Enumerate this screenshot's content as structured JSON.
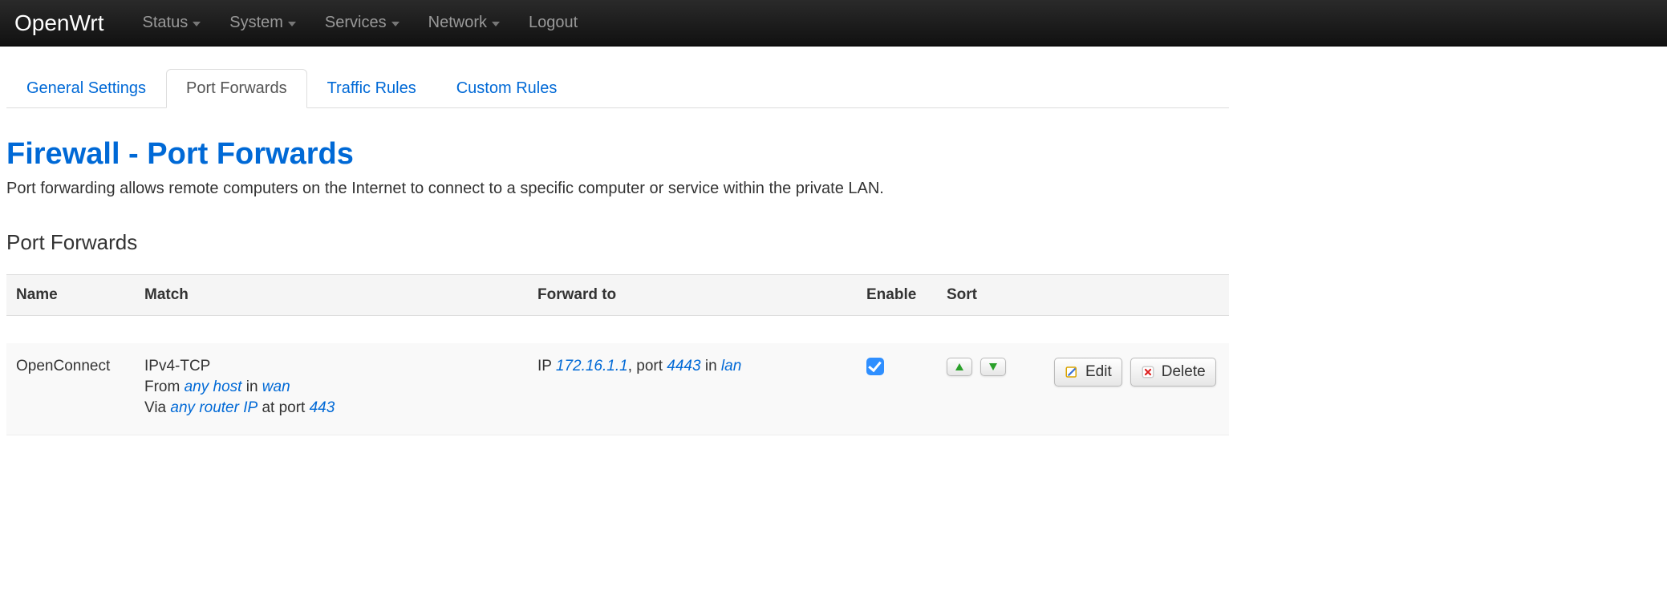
{
  "brand": "OpenWrt",
  "nav": {
    "items": [
      {
        "label": "Status",
        "dropdown": true
      },
      {
        "label": "System",
        "dropdown": true
      },
      {
        "label": "Services",
        "dropdown": true
      },
      {
        "label": "Network",
        "dropdown": true
      },
      {
        "label": "Logout",
        "dropdown": false
      }
    ]
  },
  "tabs": [
    {
      "label": "General Settings",
      "active": false
    },
    {
      "label": "Port Forwards",
      "active": true
    },
    {
      "label": "Traffic Rules",
      "active": false
    },
    {
      "label": "Custom Rules",
      "active": false
    }
  ],
  "page": {
    "title": "Firewall - Port Forwards",
    "description": "Port forwarding allows remote computers on the Internet to connect to a specific computer or service within the private LAN."
  },
  "section": {
    "title": "Port Forwards"
  },
  "table": {
    "headers": {
      "name": "Name",
      "match": "Match",
      "forward_to": "Forward to",
      "enable": "Enable",
      "sort": "Sort"
    }
  },
  "rows": [
    {
      "name": "OpenConnect",
      "match": {
        "proto": "IPv4-TCP",
        "from_prefix": "From ",
        "from_host": "any host",
        "from_mid": " in ",
        "from_zone": "wan",
        "via_prefix": "Via ",
        "via_ip": "any router IP",
        "via_mid": " at port ",
        "via_port": "443"
      },
      "forward": {
        "ip_prefix": "IP ",
        "ip": "172.16.1.1",
        "port_prefix": ", port ",
        "port": "4443",
        "zone_prefix": " in ",
        "zone": "lan"
      },
      "enabled": true
    }
  ],
  "buttons": {
    "edit": "Edit",
    "delete": "Delete"
  }
}
